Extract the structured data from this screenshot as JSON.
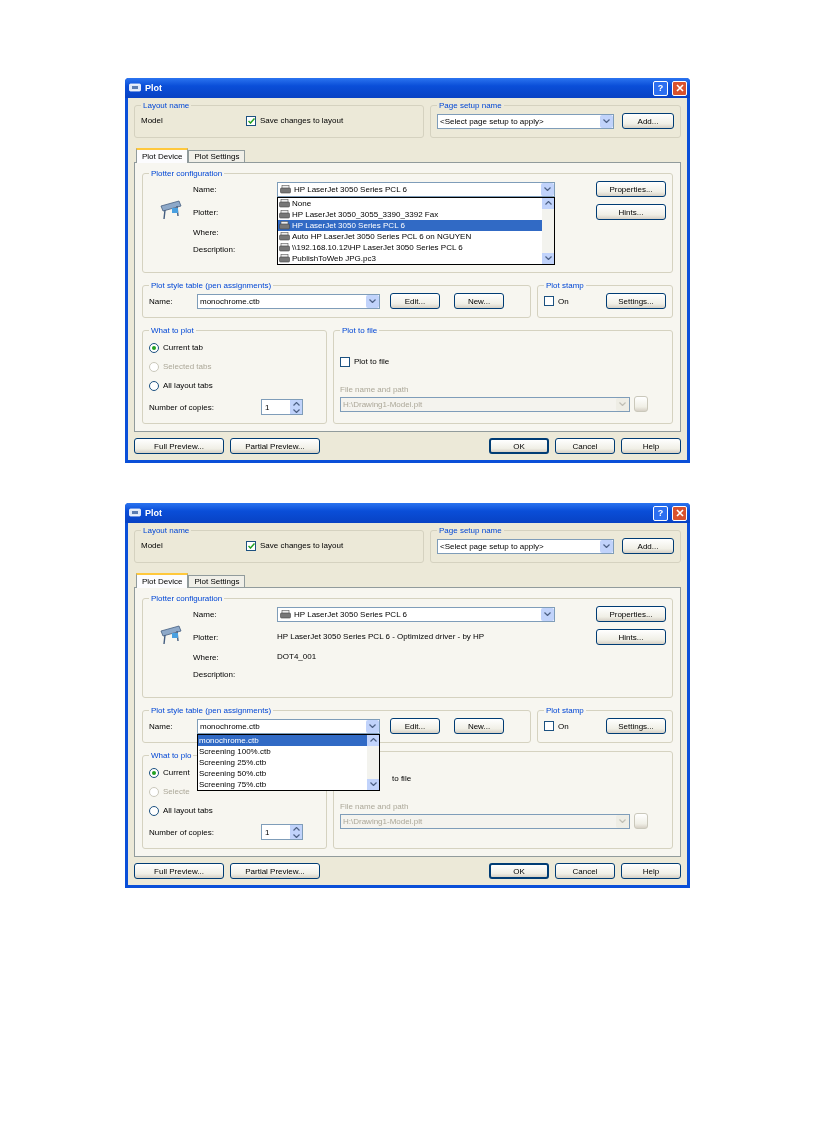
{
  "dialogs": [
    {
      "title": "Plot",
      "title_buttons": [
        "?"
      ],
      "layout_name": {
        "label": "Layout name",
        "value": "Model",
        "save_changes": {
          "label": "Save changes to layout",
          "checked": true
        }
      },
      "page_setup": {
        "label": "Page setup name",
        "value": "<Select page setup to apply>",
        "button": "Add..."
      },
      "tabs": [
        {
          "label": "Plot Device",
          "selected": true
        },
        {
          "label": "Plot Settings",
          "selected": false
        }
      ],
      "plotter": {
        "label": "Plotter configuration",
        "name_label": "Name:",
        "name_value": "HP LaserJet 3050 Series PCL 6",
        "fields": [
          {
            "label": "Plotter:"
          },
          {
            "label": "Where:"
          },
          {
            "label": "Description:"
          }
        ],
        "buttons": [
          "Properties...",
          "Hints..."
        ],
        "dropdown": [
          {
            "label": "None",
            "selected": false
          },
          {
            "label": "HP LaserJet 3050_3055_3390_3392 Fax",
            "selected": false
          },
          {
            "label": "HP LaserJet 3050 Series PCL 6",
            "selected": true
          },
          {
            "label": "Auto HP LaserJet 3050 Series PCL 6 on NGUYEN",
            "selected": false
          },
          {
            "label": "\\\\192.168.10.12\\HP LaserJet 3050 Series PCL 6",
            "selected": false
          },
          {
            "label": "PublishToWeb JPG.pc3",
            "selected": false
          }
        ]
      },
      "plot_style": {
        "label": "Plot style table (pen assignments)",
        "name_label": "Name:",
        "value": "monochrome.ctb",
        "buttons": [
          "Edit...",
          "New..."
        ]
      },
      "plot_stamp": {
        "label": "Plot stamp",
        "on": {
          "label": "On",
          "checked": false
        },
        "button": "Settings..."
      },
      "what_to_plot": {
        "label": "What to plot",
        "options": [
          {
            "label": "Current tab",
            "selected": true,
            "disabled": false
          },
          {
            "label": "Selected tabs",
            "selected": false,
            "disabled": true
          },
          {
            "label": "All layout tabs",
            "selected": false,
            "disabled": false
          }
        ],
        "copies_label": "Number of copies:",
        "copies": "1"
      },
      "plot_to_file": {
        "label": "Plot to file",
        "checkbox": {
          "label": "Plot to file",
          "checked": false
        },
        "path_label": "File name and path",
        "path": "H:\\Drawing1-Model.plt"
      },
      "buttons": [
        "Full Preview...",
        "Partial Preview...",
        "OK",
        "Cancel",
        "Help"
      ]
    },
    {
      "title": "Plot",
      "title_buttons": [
        "?"
      ],
      "layout_name": {
        "label": "Layout name",
        "value": "Model",
        "save_changes": {
          "label": "Save changes to layout",
          "checked": true
        }
      },
      "page_setup": {
        "label": "Page setup name",
        "value": "<Select page setup to apply>",
        "button": "Add..."
      },
      "tabs": [
        {
          "label": "Plot Device",
          "selected": true
        },
        {
          "label": "Plot Settings",
          "selected": false
        }
      ],
      "plotter": {
        "label": "Plotter configuration",
        "name_label": "Name:",
        "name_value": "HP LaserJet 3050 Series PCL 6",
        "fields": [
          {
            "label": "Plotter:",
            "value": "HP LaserJet 3050 Series PCL 6 - Optimized driver - by HP"
          },
          {
            "label": "Where:",
            "value": "DOT4_001"
          },
          {
            "label": "Description:"
          }
        ],
        "buttons": [
          "Properties...",
          "Hints..."
        ]
      },
      "plot_style": {
        "label": "Plot style table (pen assignments)",
        "name_label": "Name:",
        "value": "monochrome.ctb",
        "buttons": [
          "Edit...",
          "New..."
        ],
        "dropdown": [
          {
            "label": "monochrome.ctb",
            "selected": true
          },
          {
            "label": "Screening 100%.ctb",
            "selected": false
          },
          {
            "label": "Screening 25%.ctb",
            "selected": false
          },
          {
            "label": "Screening 50%.ctb",
            "selected": false
          },
          {
            "label": "Screening 75%.ctb",
            "selected": false
          }
        ]
      },
      "plot_stamp": {
        "label": "Plot stamp",
        "on": {
          "label": "On",
          "checked": false
        },
        "button": "Settings..."
      },
      "what_to_plot": {
        "label": "What to plo",
        "options": [
          {
            "label": "Current",
            "selected": true,
            "disabled": false
          },
          {
            "label": "Selecte",
            "selected": false,
            "disabled": true
          },
          {
            "label": "All layout tabs",
            "selected": false,
            "disabled": false
          }
        ],
        "copies_label": "Number of copies:",
        "copies": "1"
      },
      "plot_to_file": {
        "checkbox": {
          "label": "to file"
        },
        "path_label": "File name and path",
        "path": "H:\\Drawing1-Model.plt"
      },
      "buttons": [
        "Full Preview...",
        "Partial Preview...",
        "OK",
        "Cancel",
        "Help"
      ]
    }
  ]
}
